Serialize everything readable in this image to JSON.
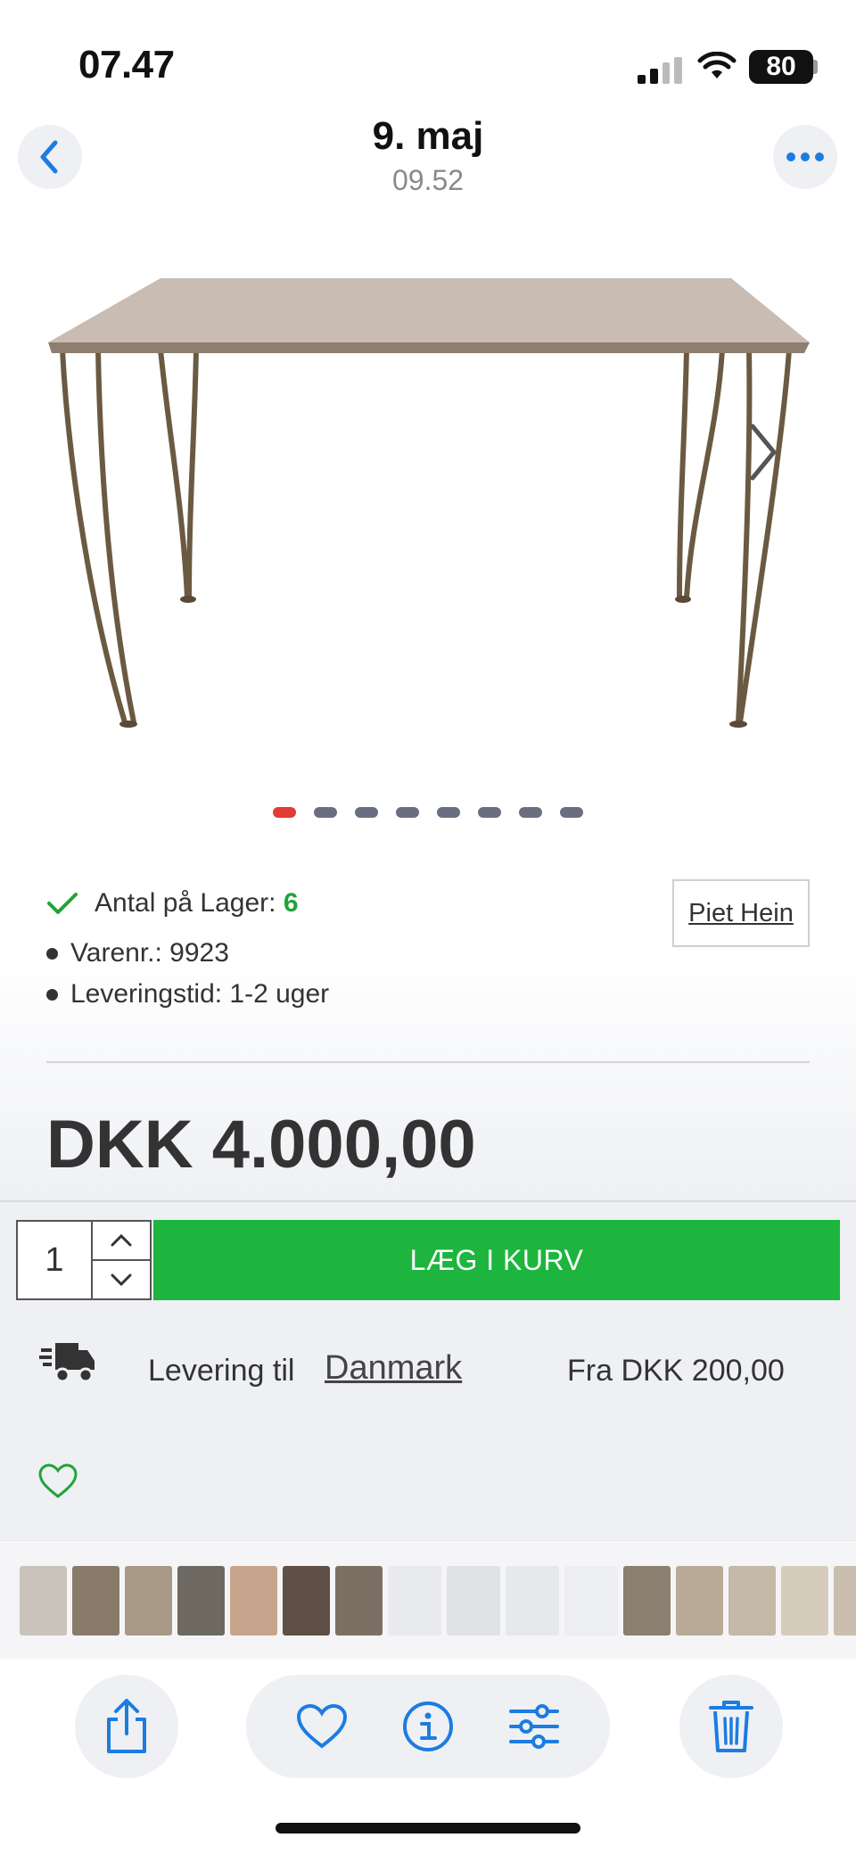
{
  "status_bar": {
    "time": "07.47",
    "battery": "80"
  },
  "header": {
    "title": "9. maj",
    "subtitle": "09.52"
  },
  "carousel": {
    "total": 8,
    "active_index": 0
  },
  "product": {
    "stock_label": "Antal på Lager:",
    "stock_count": "6",
    "item_number": "Varenr.: 9923",
    "delivery_time": "Leveringstid: 1-2 uger",
    "brand": "Piet Hein",
    "price": "DKK 4.000,00"
  },
  "cart": {
    "quantity": "1",
    "add_label": "LÆG I KURV"
  },
  "delivery": {
    "label": "Levering til",
    "country": "Danmark",
    "price": "Fra DKK 200,00"
  },
  "colors": {
    "accent": "#1db53e",
    "ios_blue": "#1c7ce0",
    "active_dot": "#e53935",
    "dot": "#6b6e80"
  },
  "icons": {
    "back": "chevron-left-icon",
    "more": "ellipsis-icon",
    "check": "check-icon",
    "truck": "truck-icon",
    "heart": "heart-icon",
    "share": "share-icon",
    "info": "info-icon",
    "adjust": "sliders-icon",
    "delete": "trash-icon"
  }
}
